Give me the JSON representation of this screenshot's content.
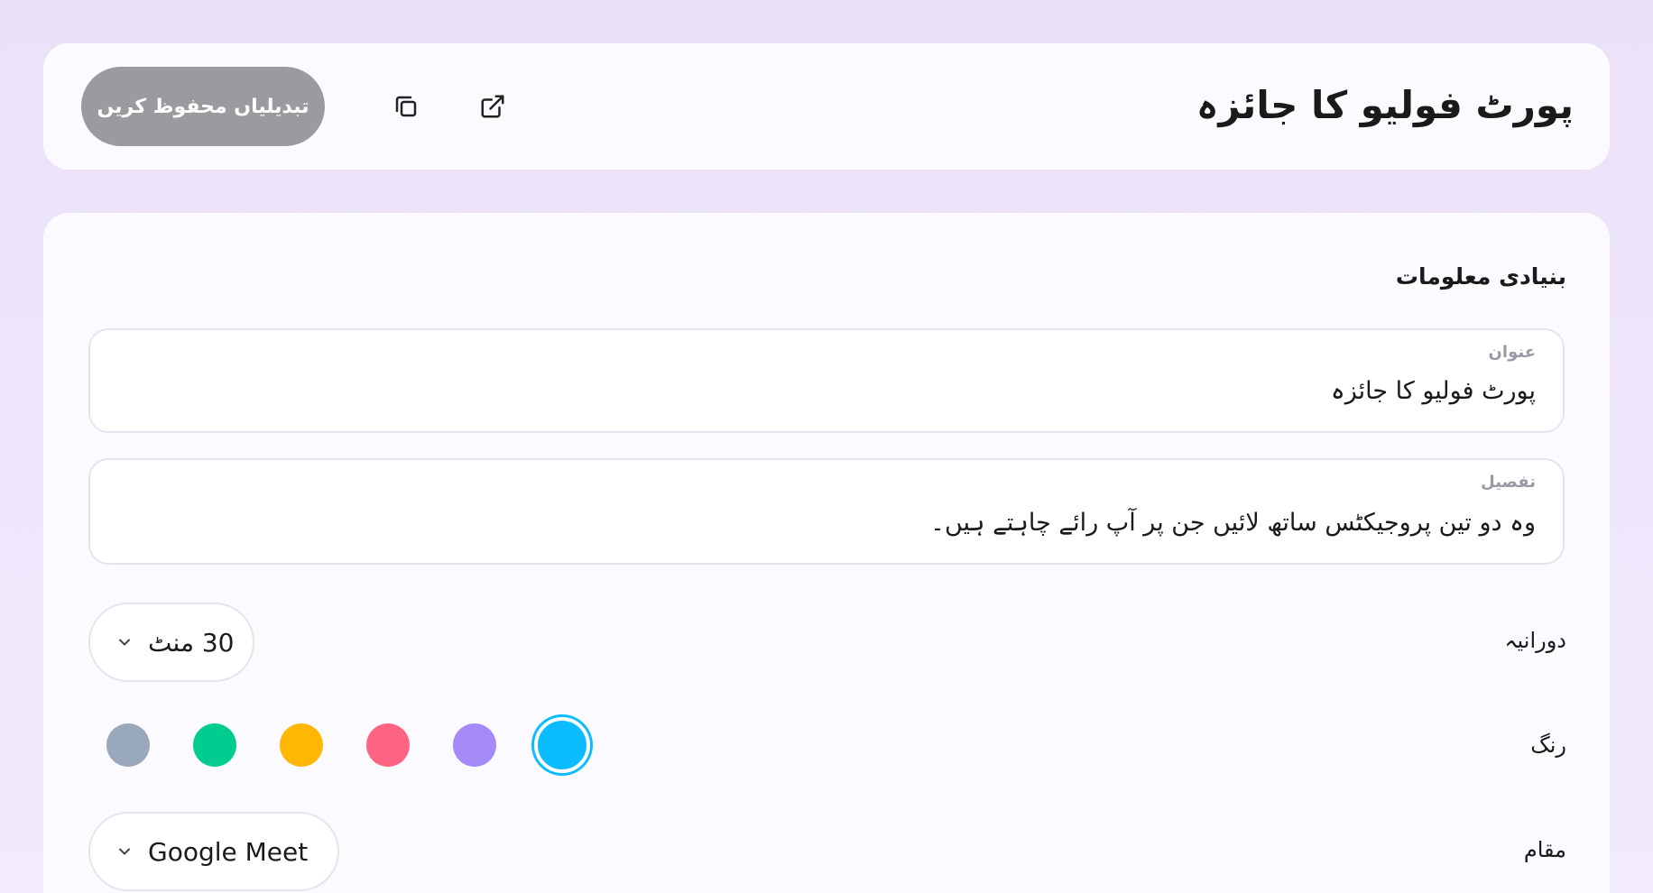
{
  "header": {
    "title": "پورٹ فولیو کا جائزہ",
    "save_label": "تبدیلیاں محفوظ کریں",
    "copy_icon": "copy-icon",
    "open_icon": "external-link-icon"
  },
  "basic_info": {
    "section_title": "بنیادی معلومات",
    "title_field": {
      "label": "عنوان",
      "value": "پورٹ فولیو کا جائزہ"
    },
    "description_field": {
      "label": "تفصیل",
      "value": "وہ دو تین پروجیکٹس ساتھ لائیں جن پر آپ رائے چاہتے ہیں۔"
    },
    "duration": {
      "label": "دورانیہ",
      "value": "30 منٹ"
    },
    "color": {
      "label": "رنگ",
      "options": [
        "#9aa8bb",
        "#00cc8f",
        "#ffb703",
        "#ff6483",
        "#a58afa",
        "#0bbcff"
      ],
      "selected": "#0bbcff"
    },
    "location": {
      "label": "مقام",
      "value": "Google Meet"
    }
  },
  "colors": {
    "background": "#ebe1fa",
    "card": "#fbfaff",
    "save_button": "#9b9b9f"
  }
}
